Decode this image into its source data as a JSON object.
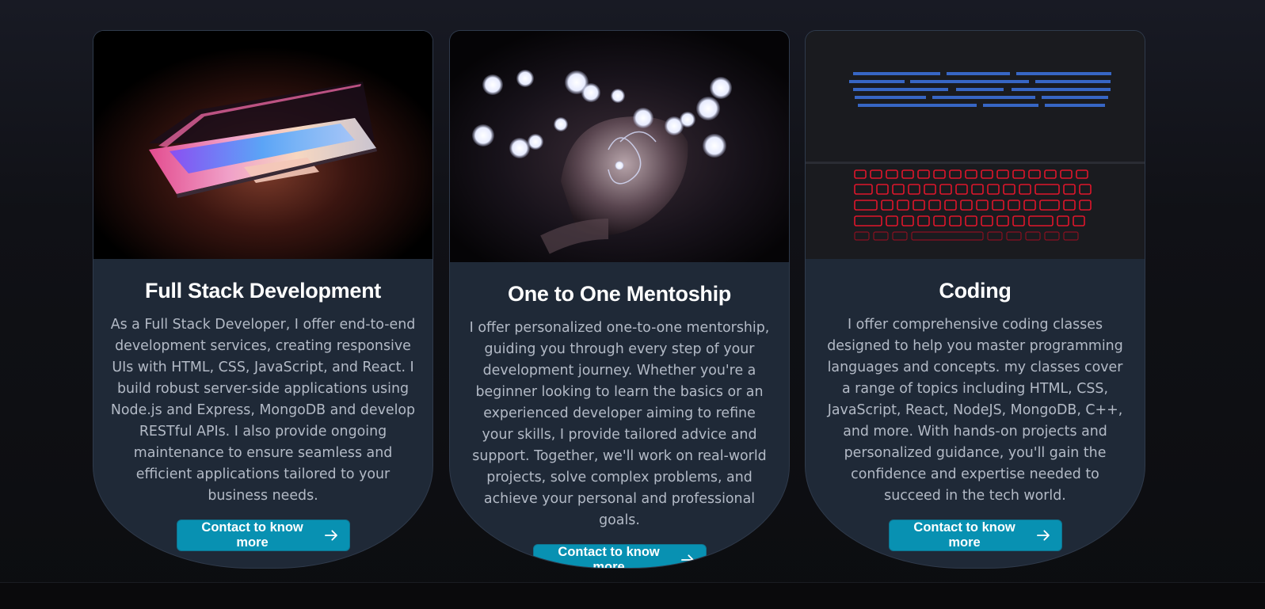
{
  "services": [
    {
      "title": "Full Stack Development",
      "description": "As a Full Stack Developer, I offer end-to-end development services, creating responsive UIs with HTML, CSS, JavaScript, and React. I build robust server-side applications using Node.js and Express, MongoDB and develop RESTful APIs. I also provide ongoing maintenance to ensure seamless and efficient applications tailored to your business needs.",
      "button_label": "Contact to know more",
      "image": "glowing-laptop-photo"
    },
    {
      "title": "One to One Mentoship",
      "description": "I offer personalized one-to-one mentorship, guiding you through every step of your development journey. Whether you're a beginner looking to learn the basics or an experienced developer aiming to refine your skills, I provide tailored advice and support. Together, we'll work on real-world projects, solve complex problems, and achieve your personal and professional goals.",
      "button_label": "Contact to know more",
      "image": "hand-with-bokeh-lights-photo"
    },
    {
      "title": "Coding",
      "description": "I offer comprehensive coding classes designed to help you master programming languages and concepts. my classes cover a range of topics including HTML, CSS, JavaScript, React, NodeJS, MongoDB, C++, and more. With hands-on projects and personalized guidance, you'll gain the confidence and expertise needed to succeed in the tech world.",
      "button_label": "Contact to know more",
      "image": "red-keyboard-code-screen-photo"
    }
  ],
  "icons": {
    "button_icon": "arrow-right-icon"
  },
  "colors": {
    "accent": "#0891b2",
    "card_bg": "#1f2937",
    "page_bg": "#111216"
  }
}
